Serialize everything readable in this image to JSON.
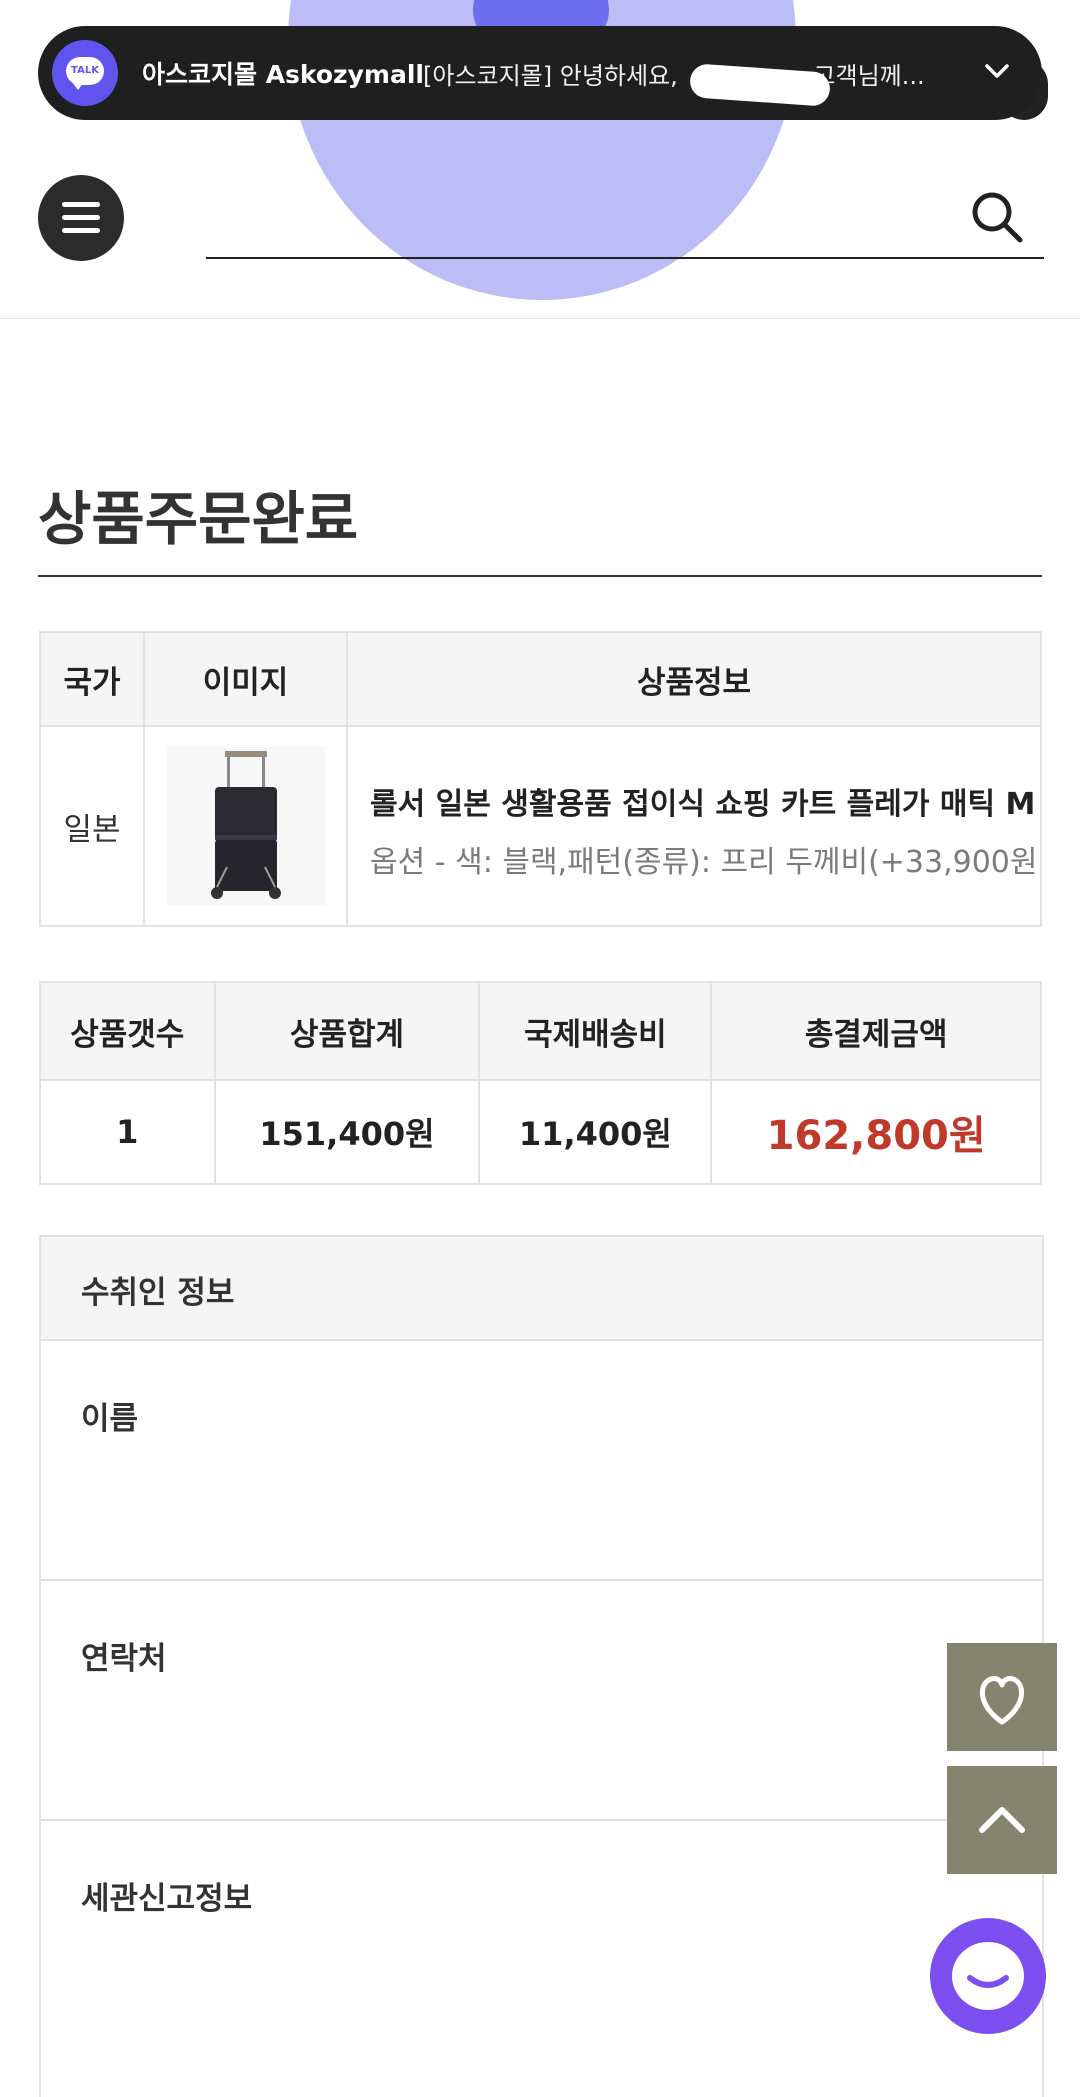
{
  "toast": {
    "sender": "아스코지몰 Askozymall",
    "message": "[아스코지몰] 안녕하세요, ",
    "message_end": "고객님께...",
    "badge": "TALK"
  },
  "page": {
    "title": "상품주문완료"
  },
  "product_table": {
    "headers": [
      "국가",
      "이미지",
      "상품정보"
    ],
    "row": {
      "country": "일본",
      "name": "롤서 일본 생활용품 접이식 쇼핑 카트 플레가 매틱 M",
      "option": "옵션 - 색: 블랙,패턴(종류): 프리 두께비(+33,900원"
    }
  },
  "summary_table": {
    "headers": [
      "상품갯수",
      "상품합계",
      "국제배송비",
      "총결제금액"
    ],
    "values": [
      "1",
      "151,400원",
      "11,400원",
      "162,800원"
    ]
  },
  "recipient": {
    "heading": "수취인 정보",
    "fields": [
      {
        "label": "이름"
      },
      {
        "label": "연락처"
      },
      {
        "label": "세관신고정보"
      }
    ]
  },
  "colors": {
    "accent_price": "#c0392b",
    "fab_bg": "#85856f",
    "chat_bg": "#7d4ff0",
    "toast_bg": "#1f1f1f"
  }
}
